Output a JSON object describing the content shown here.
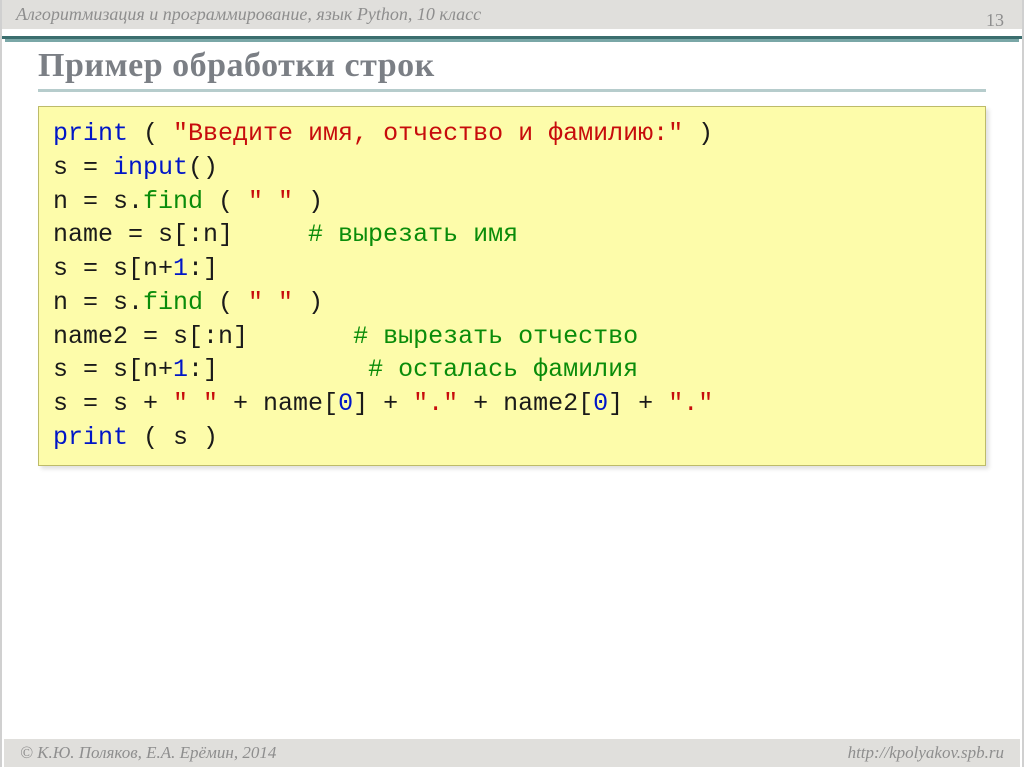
{
  "header": {
    "course_label": "Алгоритмизация и программирование, язык Python, 10 класс",
    "page_number": "13"
  },
  "title": "Пример обработки строк",
  "code": {
    "l1": {
      "kw": "print",
      "open": " ( ",
      "str": "\"Введите имя, отчество и фамилию:\"",
      "close": " )"
    },
    "l2": {
      "lhs": "s = ",
      "fn": "input",
      "args": "()"
    },
    "l3": {
      "lhs": "n = s.",
      "fn": "find",
      "open": " ( ",
      "str": "\" \"",
      "close": " )"
    },
    "l4": {
      "code": "name = s[:n]     ",
      "cmt": "# вырезать имя"
    },
    "l5": {
      "a": "s = s[n+",
      "num": "1",
      "b": ":]"
    },
    "l6": {
      "lhs": "n = s.",
      "fn": "find",
      "open": " ( ",
      "str": "\" \"",
      "close": " )"
    },
    "l7": {
      "code": "name2 = s[:n]       ",
      "cmt": "# вырезать отчество"
    },
    "l8": {
      "a": "s = s[n+",
      "num": "1",
      "b": ":]          ",
      "cmt": "# осталась фамилия"
    },
    "l9": {
      "a": "s = s + ",
      "s1": "\" \"",
      "b": " + name[",
      "n1": "0",
      "c": "] + ",
      "s2": "\".\"",
      "d": " + name2[",
      "n2": "0",
      "e": "] + ",
      "s3": "\".\""
    },
    "l10": {
      "kw": "print",
      "args": " ( s )"
    }
  },
  "footer": {
    "copyright": "© К.Ю. Поляков, Е.А. Ерёмин, 2014",
    "url": "http://kpolyakov.spb.ru"
  }
}
